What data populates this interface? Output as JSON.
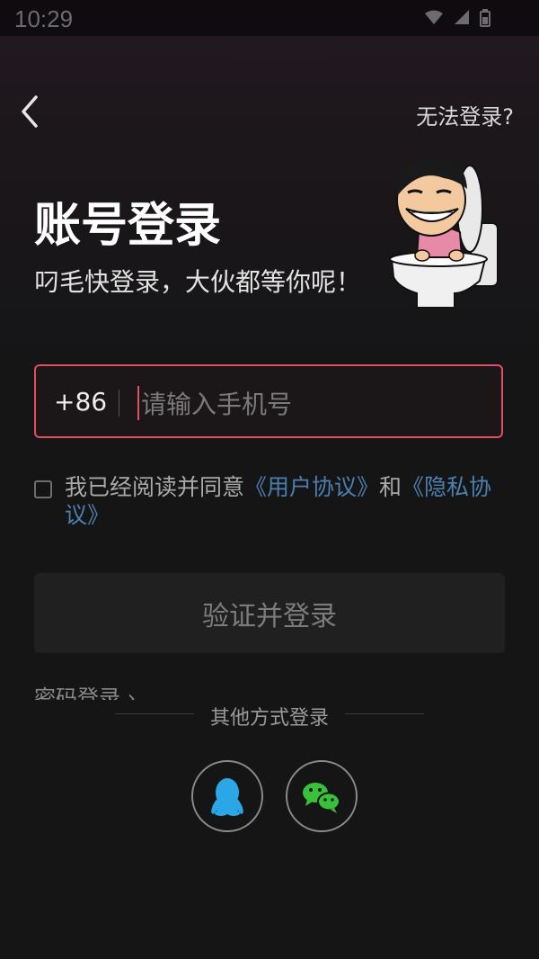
{
  "status_bar": {
    "time": "10:29"
  },
  "header": {
    "cant_login": "无法登录?"
  },
  "main": {
    "title": "账号登录",
    "subtitle": "叼毛快登录，大伙都等你呢！"
  },
  "phone": {
    "country_code": "+86",
    "placeholder": "请输入手机号"
  },
  "agreement": {
    "text_prefix": "我已经阅读并同意",
    "user_agreement": "《用户协议》",
    "and": "和",
    "privacy_agreement": "《隐私协议》"
  },
  "buttons": {
    "verify_login": "验证并登录",
    "password_login": "密码登录 ›"
  },
  "other_login": {
    "label": "其他方式登录"
  },
  "colors": {
    "accent": "#e24d63",
    "link": "#4b7fb0",
    "qq": "#2ba6e6",
    "wechat": "#39c13a"
  },
  "icons": [
    "back-icon",
    "wifi-icon",
    "signal-icon",
    "battery-icon",
    "qq-icon",
    "wechat-icon"
  ]
}
